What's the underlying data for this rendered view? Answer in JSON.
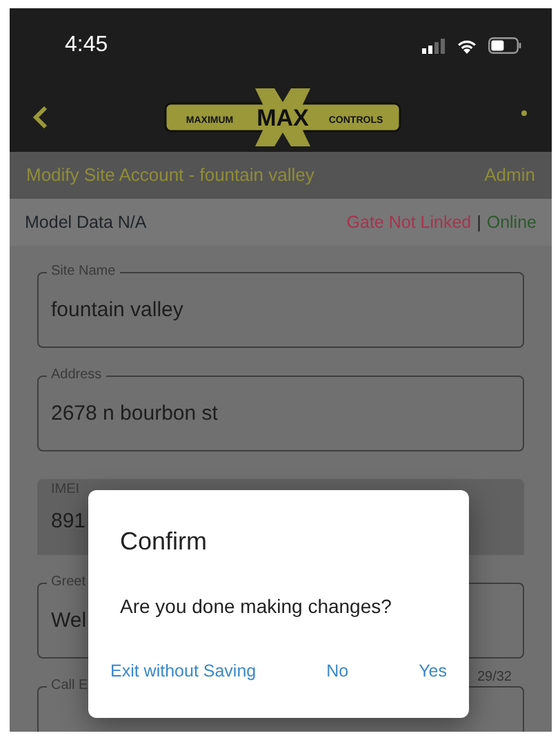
{
  "status_bar": {
    "time": "4:45"
  },
  "header": {
    "logo": [
      "MAXIMUM",
      "MAX",
      "CONTROLS"
    ]
  },
  "title_bar": {
    "title": "Modify Site Account - fountain valley",
    "role": "Admin"
  },
  "info_bar": {
    "model": "Model Data N/A",
    "gate": "Gate Not Linked",
    "separator": "|",
    "connection": "Online"
  },
  "fields": [
    {
      "kind": "outlined",
      "label": "Site Name",
      "value": "fountain valley"
    },
    {
      "kind": "outlined",
      "label": "Address",
      "value": "2678 n bourbon st"
    },
    {
      "kind": "filled",
      "label": "IMEI",
      "value": "891"
    },
    {
      "kind": "outlined",
      "label": "Greet",
      "value": "Wel",
      "counter": "29/32"
    },
    {
      "kind": "outlined",
      "label": "Call E"
    }
  ],
  "dialog": {
    "title": "Confirm",
    "message": "Are you done making changes?",
    "buttons": [
      "Exit without Saving",
      "No",
      "Yes"
    ]
  }
}
